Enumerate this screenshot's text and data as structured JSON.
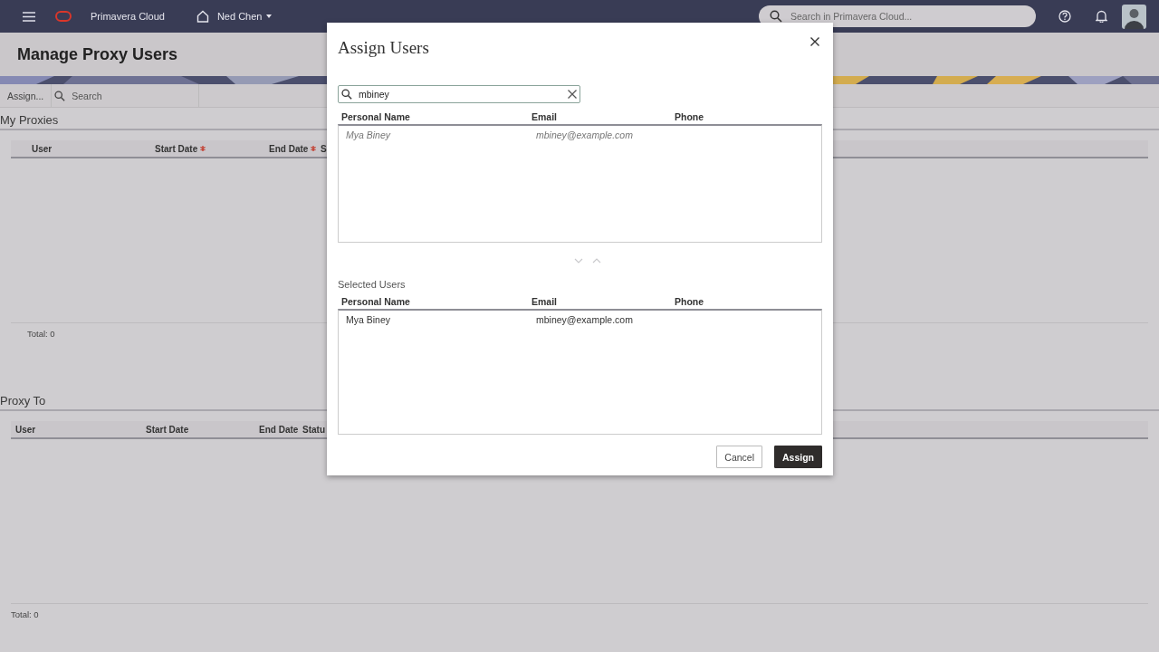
{
  "header": {
    "app_name": "Primavera Cloud",
    "workspace": "Ned Chen",
    "search": {
      "placeholder": "Search in Primavera Cloud..."
    }
  },
  "page": {
    "title": "Manage Proxy Users",
    "toolbar": {
      "assign_button": "Assign...",
      "search": {
        "placeholder": "Search"
      }
    },
    "sections": [
      {
        "title": "My Proxies",
        "columns": [
          {
            "label": "User",
            "required": false
          },
          {
            "label": "Start Date",
            "required": true
          },
          {
            "label": "End Date",
            "required": true
          },
          {
            "label": "S"
          }
        ],
        "total": "Total: 0"
      },
      {
        "title": "Proxy To",
        "columns": [
          {
            "label": "User",
            "required": false
          },
          {
            "label": "Start Date",
            "required": false
          },
          {
            "label": "End Date",
            "required": false
          },
          {
            "label": "Statu",
            "required": false
          }
        ],
        "total": "Total: 0"
      }
    ]
  },
  "dialog": {
    "title": "Assign Users",
    "search": {
      "value": "mbiney"
    },
    "available": {
      "columns": [
        "Personal Name",
        "Email",
        "Phone"
      ],
      "rows": [
        {
          "name": "Mya Biney",
          "email": "mbiney@example.com",
          "added": true
        }
      ]
    },
    "move_buttons": [
      {
        "kind": "down",
        "disabled": true
      },
      {
        "kind": "up",
        "disabled": true
      }
    ],
    "selected_label": "Selected Users",
    "selected": {
      "columns": [
        "Personal Name",
        "Email",
        "Phone"
      ],
      "rows": [
        {
          "name": "Mya Biney",
          "email": "mbiney@example.com",
          "added": false
        }
      ]
    },
    "buttons": [
      {
        "label": "Cancel",
        "kind": "secondary"
      },
      {
        "label": "Assign",
        "kind": "primary"
      }
    ]
  }
}
